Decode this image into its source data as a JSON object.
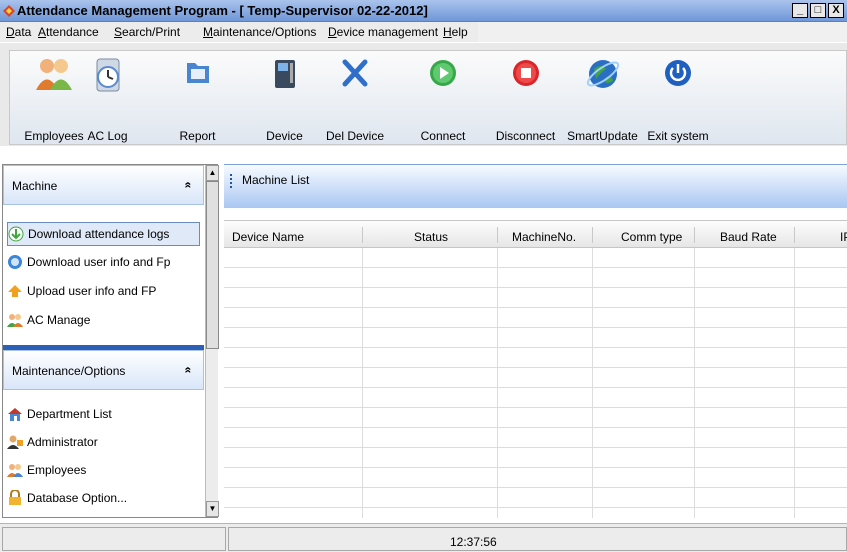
{
  "window": {
    "title": "Attendance Management Program - [ Temp-Supervisor 02-22-2012]",
    "minimize": "_",
    "maximize": "□",
    "close": "X"
  },
  "menu": [
    "Data",
    "Attendance",
    "Search/Print",
    "Maintenance/Options",
    "Device management",
    "Help"
  ],
  "toolbar": {
    "employees": "Employees",
    "ac_log": "AC Log",
    "report": "Report",
    "device": "Device",
    "del_device": "Del Device",
    "connect": "Connect",
    "disconnect": "Disconnect",
    "smart_update": "SmartUpdate",
    "exit_system": "Exit system"
  },
  "sidebar": {
    "machine_title": "Machine",
    "machine_items": [
      {
        "label": "Download attendance logs",
        "icon": "green-down-arrow-icon"
      },
      {
        "label": "Download user info and Fp",
        "icon": "blue-circle-icon"
      },
      {
        "label": "Upload user info and FP",
        "icon": "orange-up-arrow-icon"
      },
      {
        "label": "AC Manage",
        "icon": "users-icon"
      }
    ],
    "maint_title": "Maintenance/Options",
    "maint_items": [
      {
        "label": "Department List",
        "icon": "house-icon"
      },
      {
        "label": "Administrator",
        "icon": "admin-icon"
      },
      {
        "label": "Employees",
        "icon": "employees-icon"
      },
      {
        "label": "Database Option...",
        "icon": "lock-icon"
      }
    ],
    "chevron": "«"
  },
  "panel": {
    "title": "Machine List",
    "columns": [
      "Device Name",
      "Status",
      "MachineNo.",
      "Comm type",
      "Baud Rate",
      "IP"
    ]
  },
  "status": {
    "time": "12:37:56"
  },
  "colors": {
    "titlebar": "#6f97d8",
    "panel_header": "#a9c6f2",
    "selection": "#dfe9f8"
  }
}
